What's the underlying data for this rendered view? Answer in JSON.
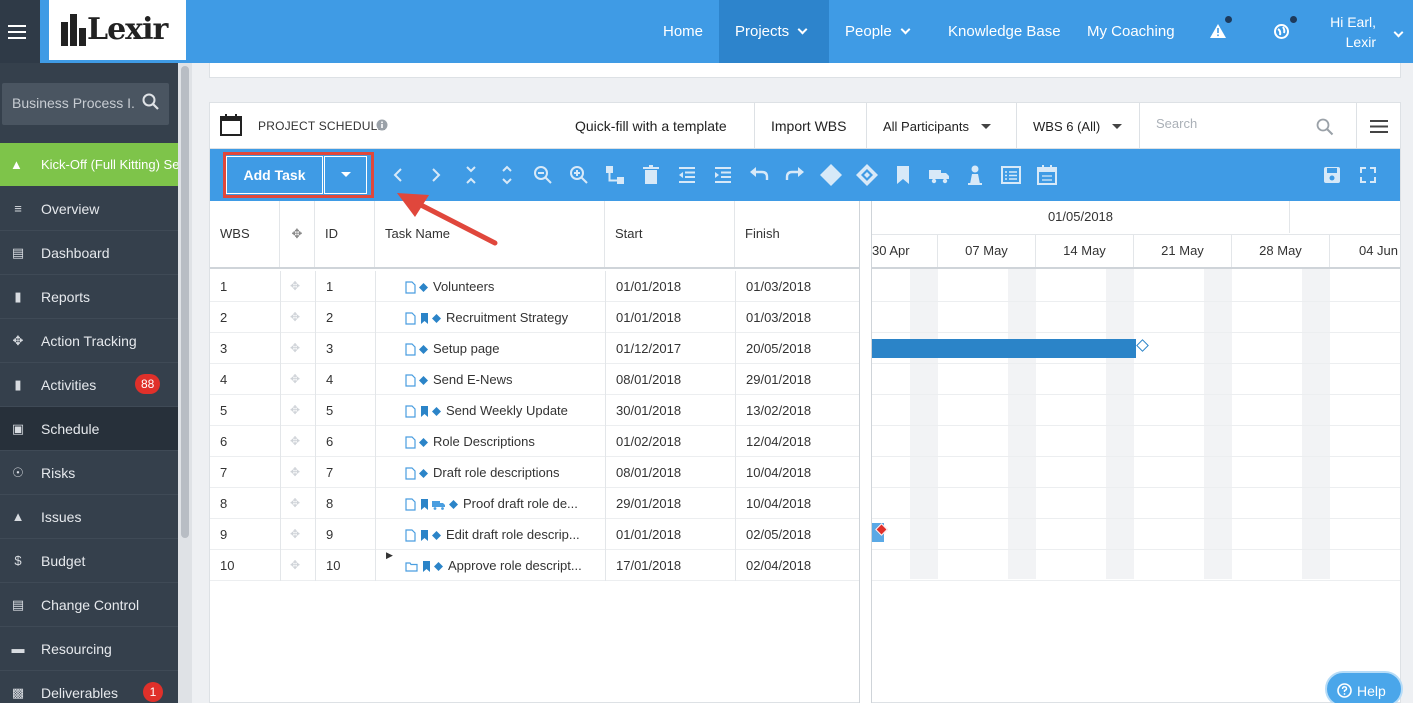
{
  "app": {
    "brand": "Lexir"
  },
  "nav": {
    "home": "Home",
    "projects": "Projects",
    "people": "People",
    "knowledge_base": "Knowledge Base",
    "my_coaching": "My Coaching",
    "greeting_line1": "Hi Earl,",
    "greeting_line2": "Lexir"
  },
  "sidebar": {
    "search_placeholder": "Business Process I...",
    "project": "Kick-Off (Full Kitting) Set",
    "items": [
      {
        "label": "Overview",
        "icon": "list-icon"
      },
      {
        "label": "Dashboard",
        "icon": "dashboard-icon"
      },
      {
        "label": "Reports",
        "icon": "bar-chart-icon"
      },
      {
        "label": "Action Tracking",
        "icon": "arrows-icon"
      },
      {
        "label": "Activities",
        "icon": "bookmark-icon",
        "badge": "88"
      },
      {
        "label": "Schedule",
        "icon": "calendar-icon",
        "active": true
      },
      {
        "label": "Risks",
        "icon": "lightbulb-icon"
      },
      {
        "label": "Issues",
        "icon": "warning-icon"
      },
      {
        "label": "Budget",
        "icon": "dollar-icon"
      },
      {
        "label": "Change Control",
        "icon": "stack-icon"
      },
      {
        "label": "Resourcing",
        "icon": "folder-icon"
      },
      {
        "label": "Deliverables",
        "icon": "truck-icon",
        "badge": "1"
      }
    ]
  },
  "schedule": {
    "title": "PROJECT SCHEDULE",
    "quick_fill": "Quick-fill with a template",
    "import_wbs": "Import WBS",
    "participants": "All Participants",
    "wbs_filter": "WBS 6 (All)",
    "search_placeholder": "Search",
    "add_task": "Add Task"
  },
  "grid": {
    "columns": [
      "WBS",
      "",
      "ID",
      "Task Name",
      "Start",
      "Finish"
    ],
    "rows": [
      {
        "wbs": "1",
        "id": "1",
        "name": "Volunteers",
        "start": "01/01/2018",
        "finish": "01/03/2018",
        "flags": "d"
      },
      {
        "wbs": "2",
        "id": "2",
        "name": "Recruitment Strategy",
        "start": "01/01/2018",
        "finish": "01/03/2018",
        "flags": "bd"
      },
      {
        "wbs": "3",
        "id": "3",
        "name": "Setup page",
        "start": "01/12/2017",
        "finish": "20/05/2018",
        "flags": "d"
      },
      {
        "wbs": "4",
        "id": "4",
        "name": "Send E-News",
        "start": "08/01/2018",
        "finish": "29/01/2018",
        "flags": "d"
      },
      {
        "wbs": "5",
        "id": "5",
        "name": "Send Weekly Update",
        "start": "30/01/2018",
        "finish": "13/02/2018",
        "flags": "bd"
      },
      {
        "wbs": "6",
        "id": "6",
        "name": "Role Descriptions",
        "start": "01/02/2018",
        "finish": "12/04/2018",
        "flags": "d"
      },
      {
        "wbs": "7",
        "id": "7",
        "name": "Draft role descriptions",
        "start": "08/01/2018",
        "finish": "10/04/2018",
        "flags": "d"
      },
      {
        "wbs": "8",
        "id": "8",
        "name": "Proof draft role de...",
        "start": "29/01/2018",
        "finish": "10/04/2018",
        "flags": "btd"
      },
      {
        "wbs": "9",
        "id": "9",
        "name": "Edit draft role descrip...",
        "start": "01/01/2018",
        "finish": "02/05/2018",
        "flags": "bd"
      },
      {
        "wbs": "10",
        "id": "10",
        "name": "Approve role descript...",
        "start": "17/01/2018",
        "finish": "02/04/2018",
        "flags": "bd",
        "folder": true
      }
    ]
  },
  "gantt": {
    "month": "01/05/2018",
    "weeks": [
      "30 Apr",
      "07 May",
      "14 May",
      "21 May",
      "28 May",
      "04 Jun"
    ]
  },
  "help": {
    "label": "Help"
  },
  "colors": {
    "primary": "#3f9be5",
    "sidebar": "#35404c",
    "active_project": "#7ec44a",
    "badge": "#e0302a",
    "highlight": "#e0473c"
  }
}
